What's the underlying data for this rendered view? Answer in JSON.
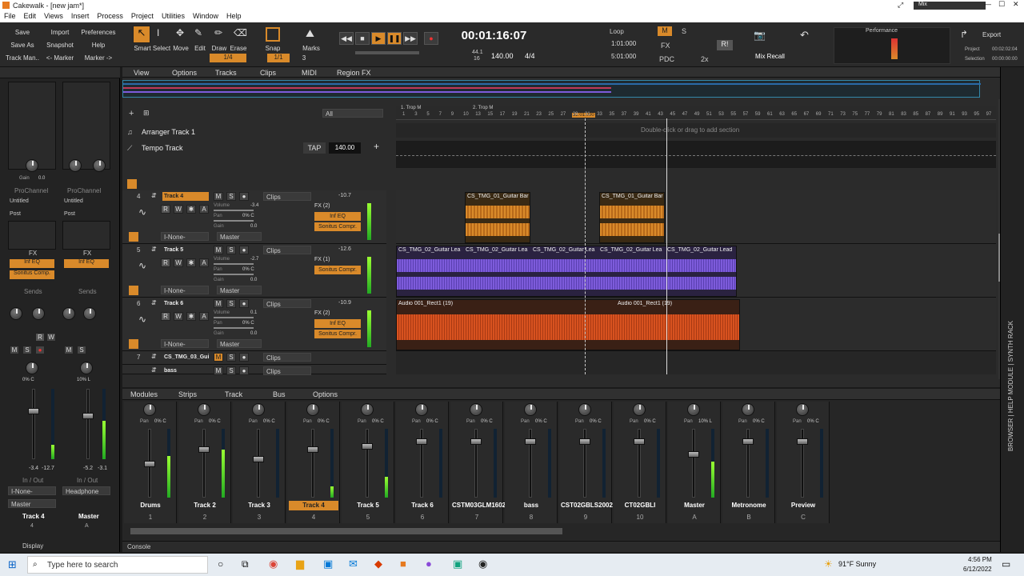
{
  "window": {
    "title": "Cakewalk - [new jam*]",
    "mix_label": "Mix"
  },
  "menu": [
    "File",
    "Edit",
    "Views",
    "Insert",
    "Process",
    "Project",
    "Utilities",
    "Window",
    "Help"
  ],
  "control_bar": {
    "project_buttons": [
      "Save",
      "Import",
      "Preferences",
      "Save As",
      "Snapshot",
      "Help",
      "Track Man..",
      "<- Marker",
      "Marker ->"
    ],
    "tools": [
      "Smart",
      "Select",
      "Move",
      "Edit",
      "Draw",
      "Erase"
    ],
    "snap_label": "Snap",
    "marks_label": "Marks",
    "snap_value": "1/4",
    "snap_value2": "1/1",
    "marks_value": "3",
    "time": "00:01:16:07",
    "sample_rate": "44.1",
    "bit_depth": "16",
    "tempo": "140.00",
    "meter": "4/4",
    "loop_label": "Loop",
    "loop_start": "1:01:000",
    "loop_end": "5:01:000",
    "mix_buttons": [
      "M",
      "S",
      "FX",
      "PDC",
      "2x",
      "R!"
    ],
    "mix_recall": "Mix Recall",
    "performance_label": "Performance",
    "export_label": "Export",
    "project_label": "Project",
    "selection_label": "Selection",
    "project_time": "00:02:02:04",
    "selection_time": "00:00:00:00"
  },
  "view_menu": [
    "View",
    "Options",
    "Tracks",
    "Clips",
    "MIDI",
    "Region FX"
  ],
  "track_filter": "All",
  "arranger": {
    "name": "Arranger Track 1",
    "hint": "Double-click or drag to add section"
  },
  "tempo_track": {
    "name": "Tempo Track",
    "tap": "TAP",
    "value": "140.00"
  },
  "tracks": [
    {
      "num": "4",
      "name": "Track 4",
      "vol_db": "-10.7",
      "volume": "-3.4",
      "pan": "0% C",
      "gain": "0.0",
      "fx": "FX (2)",
      "fx1": "Inf EQ",
      "fx2": "Sonitus Compr.",
      "input": "I-None-",
      "output": "Master",
      "clips": "Clips"
    },
    {
      "num": "5",
      "name": "Track 5",
      "vol_db": "-12.6",
      "volume": "-2.7",
      "pan": "0% C",
      "gain": "0.0",
      "fx": "FX (1)",
      "fx1": "Sonitus Compr.",
      "fx2": "",
      "input": "I-None-",
      "output": "Master",
      "clips": "Clips"
    },
    {
      "num": "6",
      "name": "Track 6",
      "vol_db": "-10.9",
      "volume": "0.1",
      "pan": "0% C",
      "gain": "0.0",
      "fx": "FX (2)",
      "fx1": "Inf EQ",
      "fx2": "Sonitus Compr.",
      "input": "I-None-",
      "output": "Master",
      "clips": "Clips"
    },
    {
      "num": "7",
      "name": "CS_TMG_03_Gui",
      "clips": "Clips"
    },
    {
      "name": "bass",
      "clips": "Clips"
    }
  ],
  "timeline": {
    "markers": [
      "1. Trop M",
      "2. Trop M"
    ],
    "now_time": "32:01:000",
    "bars": [
      "1",
      "3",
      "5",
      "7",
      "9",
      "10",
      "13",
      "15",
      "17",
      "19",
      "21",
      "23",
      "25",
      "27",
      "29",
      "31",
      "33",
      "35",
      "37",
      "39",
      "41",
      "43",
      "45",
      "47",
      "49",
      "51",
      "53",
      "55",
      "57",
      "59",
      "61",
      "63",
      "65",
      "67",
      "69",
      "71",
      "73",
      "75",
      "77",
      "79",
      "81",
      "83",
      "85",
      "87",
      "89",
      "91",
      "93",
      "95",
      "97"
    ],
    "clips": [
      {
        "name": "CS_TMG_01_Guitar Bar"
      },
      {
        "name": "CS_TMG_01_Guitar Bar"
      },
      {
        "name": "CS_TMG_02_Guitar Lea"
      },
      {
        "name": "CS_TMG_02_Guitar Lea"
      },
      {
        "name": "CS_TMG_02_Guitar Lea"
      },
      {
        "name": "CS_TMG_02_Guitar Lea"
      },
      {
        "name": "CS_TMG_02_Guitar Lead"
      },
      {
        "name": "Audio 001_Rect1 (19)"
      },
      {
        "name": "Audio 001_Rect1 (19)"
      }
    ]
  },
  "inspector": {
    "gain_label": "Gain",
    "gain_value": "0.0",
    "prochannel": "ProChannel",
    "untitled": "Untitled",
    "post": "Post",
    "fx_label": "FX",
    "fx1": "Inf EQ",
    "fx2": "Sonitus Comp.",
    "sends": "Sends",
    "pan_left": "0% C",
    "pan_right": "10% L",
    "vol_left": "-3.4",
    "vol_left2": "-12.7",
    "vol_right": "-5.2",
    "vol_right2": "-3.1",
    "io_label": "In / Out",
    "in_left": "I-None-",
    "out_left": "Master",
    "out_right": "Headphone",
    "track_left": "Track 4",
    "num_left": "4",
    "track_right": "Master",
    "num_right": "A",
    "display": "Display"
  },
  "console": {
    "tabs": [
      "Modules",
      "Strips",
      "Track",
      "Bus",
      "Options"
    ],
    "strips": [
      {
        "name": "Drums",
        "num": "1",
        "pan": "0% C"
      },
      {
        "name": "Track 2",
        "num": "2",
        "pan": "0% C"
      },
      {
        "name": "Track 3",
        "num": "3",
        "pan": "0% C"
      },
      {
        "name": "Track 4",
        "num": "4",
        "pan": "0% C"
      },
      {
        "name": "Track 5",
        "num": "5",
        "pan": "0% C"
      },
      {
        "name": "Track 6",
        "num": "6",
        "pan": "0% C"
      },
      {
        "name": "CSTM03GLM1602",
        "num": "7",
        "pan": "0% C"
      },
      {
        "name": "bass",
        "num": "8",
        "pan": "0% C"
      },
      {
        "name": "CST02GBLS2002",
        "num": "9",
        "pan": "0% C"
      },
      {
        "name": "CT02GBLI",
        "num": "10",
        "pan": "0% C"
      },
      {
        "name": "Master",
        "num": "A",
        "pan": "10% L"
      },
      {
        "name": "Metronome",
        "num": "B",
        "pan": "0% C"
      },
      {
        "name": "Preview",
        "num": "C",
        "pan": "0% C"
      }
    ],
    "tab_label": "Console"
  },
  "right_dock": "BROWSER | HELP MODULE | SYNTH RACK",
  "taskbar": {
    "search": "Type here to search",
    "weather": "91°F  Sunny",
    "time": "4:56 PM",
    "date": "6/12/2022"
  },
  "colors": {
    "accent": "#d98a2a",
    "wave_orange": "#d98a2a",
    "wave_purple": "#7d5bdb",
    "wave_red": "#d8521f"
  }
}
